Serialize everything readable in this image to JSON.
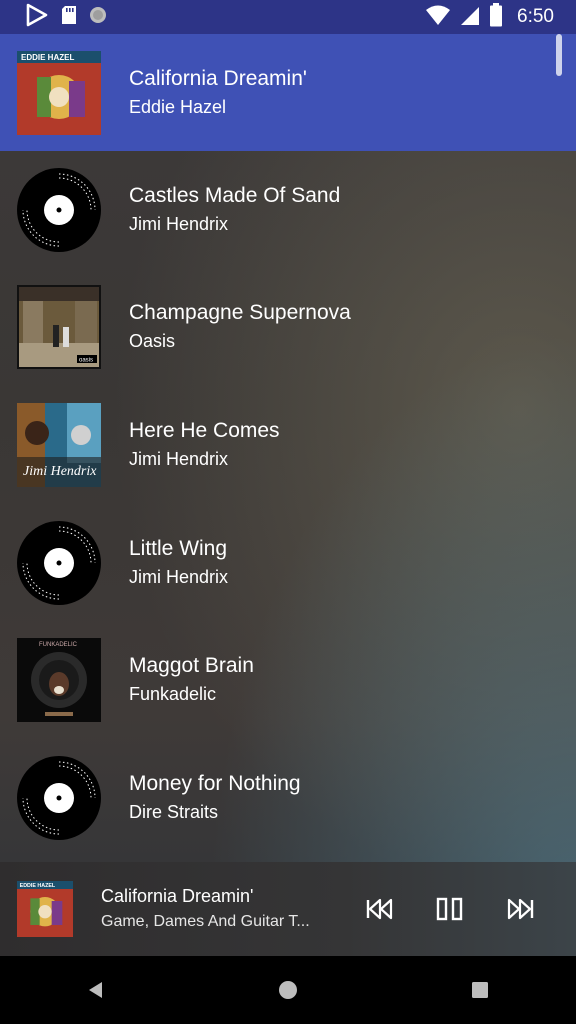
{
  "status_bar": {
    "time": "6:50",
    "icons": [
      "play-store-icon",
      "sd-card-icon",
      "circle-notification-icon",
      "wifi-icon",
      "signal-icon",
      "battery-icon"
    ]
  },
  "songs": [
    {
      "title": "California Dreamin'",
      "artist": "Eddie Hazel",
      "art": "eddie-hazel-album-art",
      "art_label": "EDDIE HAZEL",
      "selected": true
    },
    {
      "title": "Castles Made Of Sand",
      "artist": "Jimi Hendrix",
      "art": "vinyl-record-icon"
    },
    {
      "title": "Champagne Supernova",
      "artist": "Oasis",
      "art": "oasis-album-art",
      "art_label": "oasis"
    },
    {
      "title": "Here He Comes",
      "artist": "Jimi Hendrix",
      "art": "jimi-hendrix-album-art",
      "art_label": "Jimi Hendrix"
    },
    {
      "title": "Little Wing",
      "artist": "Jimi Hendrix",
      "art": "vinyl-record-icon"
    },
    {
      "title": "Maggot Brain",
      "artist": "Funkadelic",
      "art": "funkadelic-album-art",
      "art_label": "FUNKADELIC"
    },
    {
      "title": "Money for Nothing",
      "artist": "Dire Straits",
      "art": "vinyl-record-icon"
    }
  ],
  "player": {
    "title": "California Dreamin'",
    "subtitle": "Game, Dames And Guitar T...",
    "art": "eddie-hazel-album-art",
    "art_label": "EDDIE HAZEL",
    "controls": [
      "skip-previous-icon",
      "pause-icon",
      "skip-next-icon"
    ]
  },
  "nav": [
    "back-icon",
    "home-icon",
    "recents-icon"
  ],
  "colors": {
    "status_bar": "#2d3487",
    "selected_row": "#3f51b5",
    "nav_bar": "#000000"
  }
}
